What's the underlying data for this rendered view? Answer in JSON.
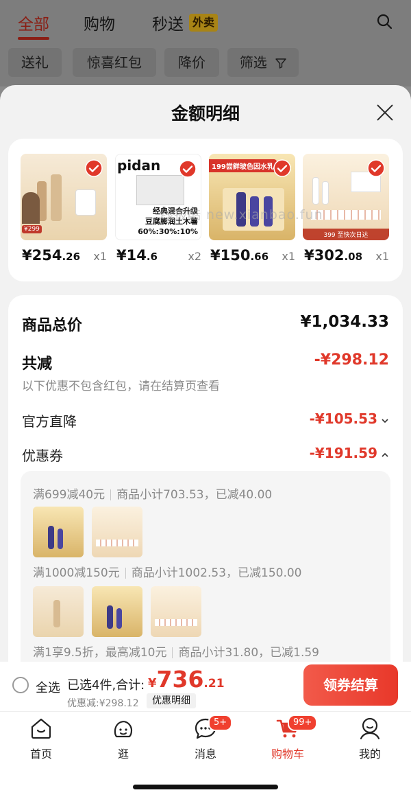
{
  "top_nav": {
    "tabs": [
      {
        "label": "全部",
        "active": true
      },
      {
        "label": "购物",
        "active": false
      },
      {
        "label": "秒送",
        "active": false
      }
    ],
    "waimai_badge": "外卖"
  },
  "filters": [
    "送礼",
    "惊喜红包",
    "降价",
    "筛选"
  ],
  "sheet": {
    "title": "金额明细",
    "watermark": "线报酷 new.xianbao.fun",
    "products": [
      {
        "price_int": "¥254",
        "price_dec": ".26",
        "qty": "x1",
        "badge": "¥299"
      },
      {
        "price_int": "¥14",
        "price_dec": ".6",
        "qty": "x2",
        "brand": "pidan",
        "caption_1": "经典混合升级",
        "caption_2": "豆腐膨润土木薯",
        "caption_3": "60%:30%:10%"
      },
      {
        "price_int": "¥150",
        "price_dec": ".66",
        "qty": "x1",
        "badge": "199尝鲜玻色因水乳"
      },
      {
        "price_int": "¥302",
        "price_dec": ".08",
        "qty": "x1",
        "badge": "399 至快次日达"
      }
    ],
    "summary": {
      "goods_total_label": "商品总价",
      "goods_total_value": "¥1,034.33",
      "reduction_label": "共减",
      "reduction_value": "-¥298.12",
      "reduction_note": "以下优惠不包含红包，请在结算页查看",
      "official_label": "官方直降",
      "official_value": "-¥105.53",
      "coupon_label": "优惠券",
      "coupon_value": "-¥191.59"
    },
    "coupons": [
      {
        "rule": "满699减40元",
        "detail": "商品小计703.53，已减40.00"
      },
      {
        "rule": "满1000减150元",
        "detail": "商品小计1002.53，已减150.00"
      },
      {
        "rule": "满1享9.5折，最高减10元",
        "detail": "商品小计31.80，已减1.59"
      }
    ]
  },
  "checkout": {
    "select_all": "全选",
    "selected_summary": "已选4件,合计:",
    "total_currency": "¥",
    "total_int": "736",
    "total_dec": ".21",
    "discount_text": "优惠减:¥298.12",
    "detail_link": "优惠明细",
    "button": "领券结算"
  },
  "tabbar": [
    {
      "label": "首页",
      "icon": "home-icon"
    },
    {
      "label": "逛",
      "icon": "browse-icon"
    },
    {
      "label": "消息",
      "icon": "message-icon",
      "badge": "5+"
    },
    {
      "label": "购物车",
      "icon": "cart-icon",
      "badge": "99+",
      "active": true
    },
    {
      "label": "我的",
      "icon": "profile-icon"
    }
  ],
  "colors": {
    "accent": "#e0382a",
    "sheet_bg": "#f2f2f2",
    "overlay": "#7d7d7d"
  }
}
